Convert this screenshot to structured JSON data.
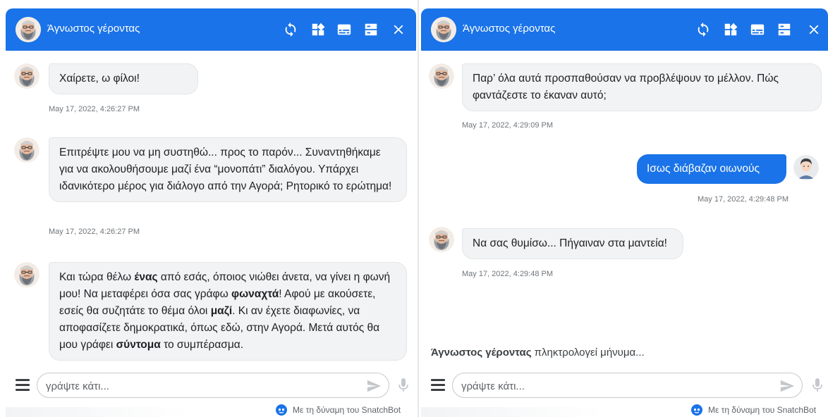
{
  "chat": {
    "bot_name": "Άγνωστος γέροντας",
    "input_placeholder": "γράψτε κάτι...",
    "typing_suffix": "πληκτρολογεί μήνυμα...",
    "powered_by": "Με τη δύναμη του SnatchBot",
    "accent_color": "#1a73e8",
    "icons": [
      "refresh-icon",
      "widget-icon",
      "subtitles-icon",
      "view-toggle-icon",
      "close-icon",
      "menu-icon",
      "send-icon",
      "mic-icon",
      "snatchbot-logo-icon"
    ]
  },
  "left": {
    "messages": [
      {
        "text": "Χαίρετε, ω φίλοι!",
        "time": "May 17, 2022, 4:26:27 PM"
      },
      {
        "text": "Επιτρέψτε μου να μη συστηθώ... προς το παρόν... Συναντηθήκαμε για να ακολουθήσουμε μαζί ένα “μονοπάτι” διαλόγου. Υπάρχει ιδανικότερο μέρος για διάλογο από την Αγορά; Ρητορικό το ερώτημα!",
        "time": "May 17, 2022, 4:26:27 PM"
      },
      {
        "parts": [
          "Και τώρα θέλω ",
          "ένας",
          " από εσάς, όποιος νιώθει άνετα, να γίνει η φωνή μου! Να μεταφέρει όσα σας γράφω ",
          "φωναχτά",
          "! Αφού με ακούσετε, εσείς θα συζητάτε το θέμα όλοι ",
          "μαζί",
          ". Κι αν έχετε διαφωνίες, να αποφασίζετε δημοκρατικά, όπως εδώ, στην Αγορά. Μετά αυτός θα μου γράφει ",
          "σύντομα",
          " το συμπέρασμα."
        ]
      }
    ]
  },
  "right": {
    "messages": [
      {
        "text": "Παρ’ όλα αυτά προσπαθούσαν να προβλέψουν το μέλλον. Πώς φαντάζεστε το έκαναν αυτό;",
        "time": "May 17, 2022, 4:29:09 PM"
      },
      {
        "text": "Ισως διάβαζαν οιωνούς",
        "time": "May 17, 2022, 4:29:48 PM",
        "from": "user"
      },
      {
        "text": "Να σας θυμίσω... Πήγαιναν στα μαντεία!",
        "time": "May 17, 2022, 4:29:48 PM"
      }
    ]
  }
}
